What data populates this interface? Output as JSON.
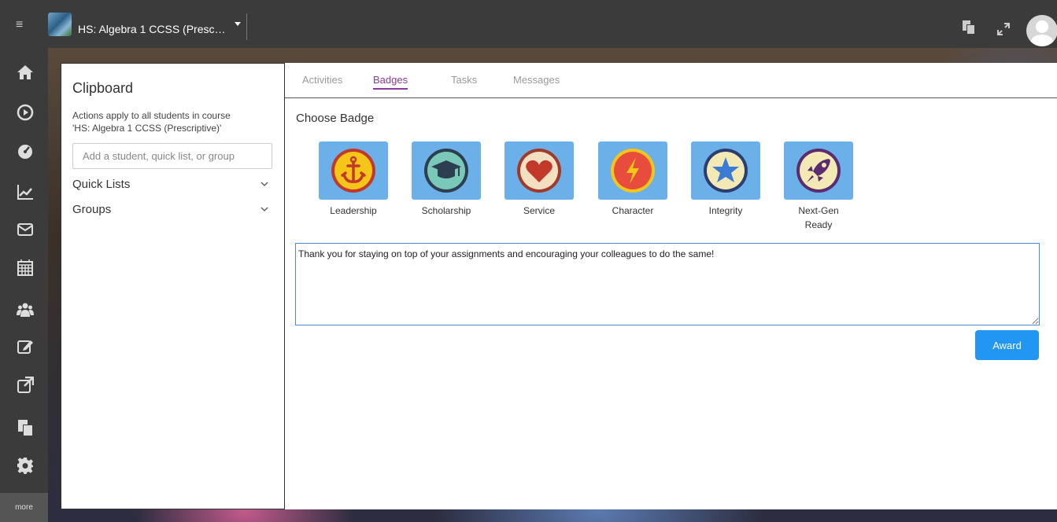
{
  "topbar": {
    "course_name": "HS: Algebra 1 CCSS (Presc…",
    "menu_icon": "hamburger-icon",
    "copy_icon": "clipboard-copy-icon",
    "expand_icon": "expand-icon",
    "avatar_icon": "user-avatar-icon"
  },
  "sidenav": {
    "items": [
      {
        "icon": "home-icon"
      },
      {
        "icon": "play-circle-icon"
      },
      {
        "icon": "dashboard-gauge-icon"
      },
      {
        "icon": "line-chart-icon"
      },
      {
        "icon": "envelope-icon"
      },
      {
        "icon": "calendar-icon"
      },
      {
        "icon": "users-icon"
      },
      {
        "icon": "edit-icon"
      },
      {
        "icon": "external-link-icon"
      },
      {
        "icon": "clipboard-icon"
      },
      {
        "icon": "gear-icon"
      }
    ],
    "more_label": "more"
  },
  "clipboard": {
    "title": "Clipboard",
    "description_line1": "Actions apply to all students in course",
    "description_line2": "'HS: Algebra 1 CCSS (Prescriptive)'",
    "search_placeholder": "Add a student, quick list, or group",
    "search_value": "",
    "sections": [
      {
        "label": "Quick Lists"
      },
      {
        "label": "Groups"
      }
    ]
  },
  "main": {
    "tabs": [
      {
        "label": "Activities",
        "active": false
      },
      {
        "label": "Badges",
        "active": true
      },
      {
        "label": "Tasks",
        "active": false
      },
      {
        "label": "Messages",
        "active": false
      }
    ],
    "choose_title": "Choose Badge",
    "badges": [
      {
        "label": "Leadership",
        "icon": "anchor-icon",
        "color": "#f5c518"
      },
      {
        "label": "Scholarship",
        "icon": "graduation-cap-icon",
        "color": "#7ac9b8"
      },
      {
        "label": "Service",
        "icon": "heart-icon",
        "color": "#c0392b"
      },
      {
        "label": "Character",
        "icon": "lightning-icon",
        "color": "#e74c3c"
      },
      {
        "label": "Integrity",
        "icon": "star-icon",
        "color": "#3a7bd5"
      },
      {
        "label": "Next-Gen Ready",
        "label_line1": "Next-Gen",
        "label_line2": "Ready",
        "icon": "rocket-icon",
        "color": "#5b2c6f"
      }
    ],
    "message_text": "Thank you for staying on top of your assignments and encouraging your colleagues to do the same!",
    "award_label": "Award"
  },
  "colors": {
    "accent_purple": "#8a3aa0",
    "award_blue": "#2196f3",
    "badge_tile": "#6bb0e8",
    "chrome": "#3b3b3b"
  }
}
